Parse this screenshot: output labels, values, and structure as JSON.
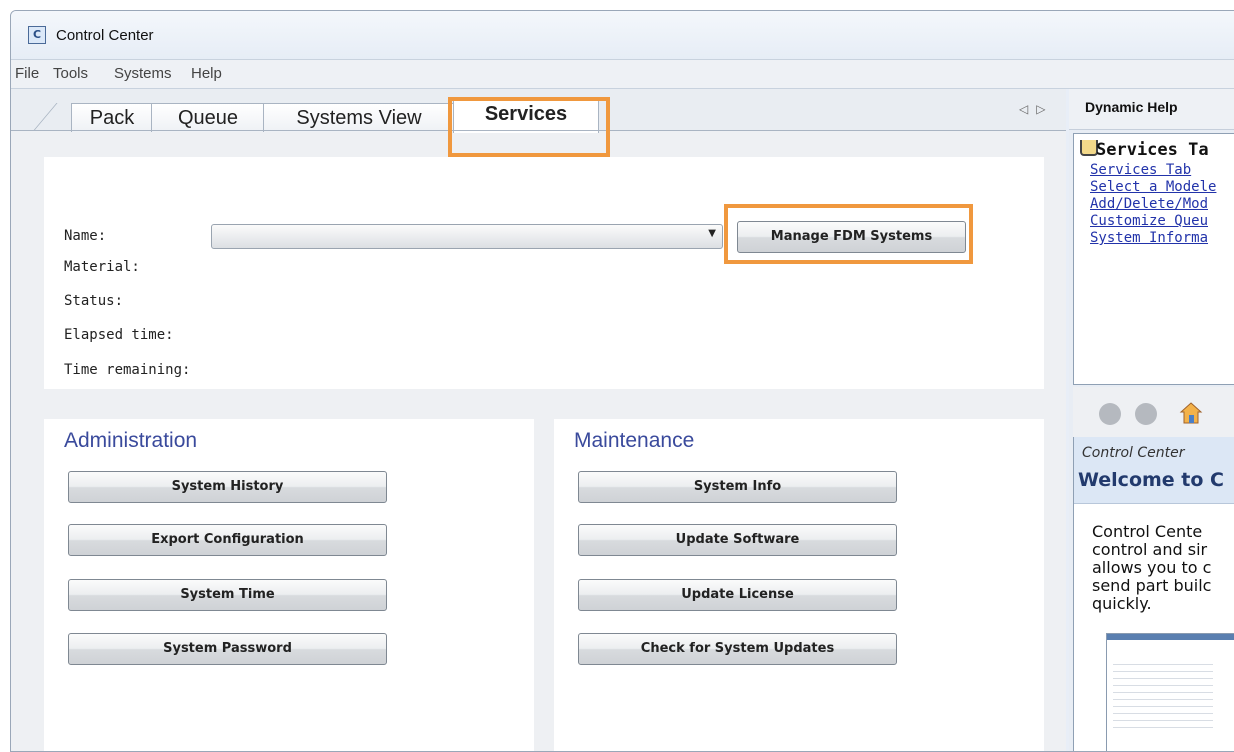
{
  "window": {
    "title": "Control Center",
    "icon": "control-center-app-icon"
  },
  "menu": [
    "File",
    "Tools",
    "Systems",
    "Help"
  ],
  "tabs": [
    {
      "label": "Pack"
    },
    {
      "label": "Queue"
    },
    {
      "label": "Systems View"
    },
    {
      "label": "Services",
      "active": true
    }
  ],
  "services": {
    "fields": {
      "name": "Name:",
      "material": "Material:",
      "status": "Status:",
      "elapsed": "Elapsed time:",
      "remaining": "Time remaining:"
    },
    "name_select_value": "",
    "manage_button": "Manage FDM Systems"
  },
  "administration": {
    "title": "Administration",
    "buttons": [
      "System History",
      "Export Configuration",
      "System Time",
      "System Password"
    ]
  },
  "maintenance": {
    "title": "Maintenance",
    "buttons": [
      "System Info",
      "Update Software",
      "Update License",
      "Check for System Updates"
    ]
  },
  "dynamic_help": {
    "title": "Dynamic Help",
    "heading": "Services Ta",
    "links": [
      "Services Tab",
      "Select a Modele",
      "Add/Delete/Mod",
      "Customize Queu",
      "System Informa"
    ],
    "banner_small": "Control Center",
    "banner_big": "Welcome to C",
    "body_lines": [
      "Control Cente",
      "control and sir",
      "allows you to c",
      "send part builc",
      "quickly."
    ]
  },
  "highlight_color": "#f0983e",
  "icons": [
    "control-center-app-icon",
    "help-book-icon",
    "back-arrow-icon",
    "forward-arrow-icon",
    "home-icon",
    "dropdown-arrow-icon",
    "tab-scroll-left-icon",
    "tab-scroll-right-icon"
  ]
}
